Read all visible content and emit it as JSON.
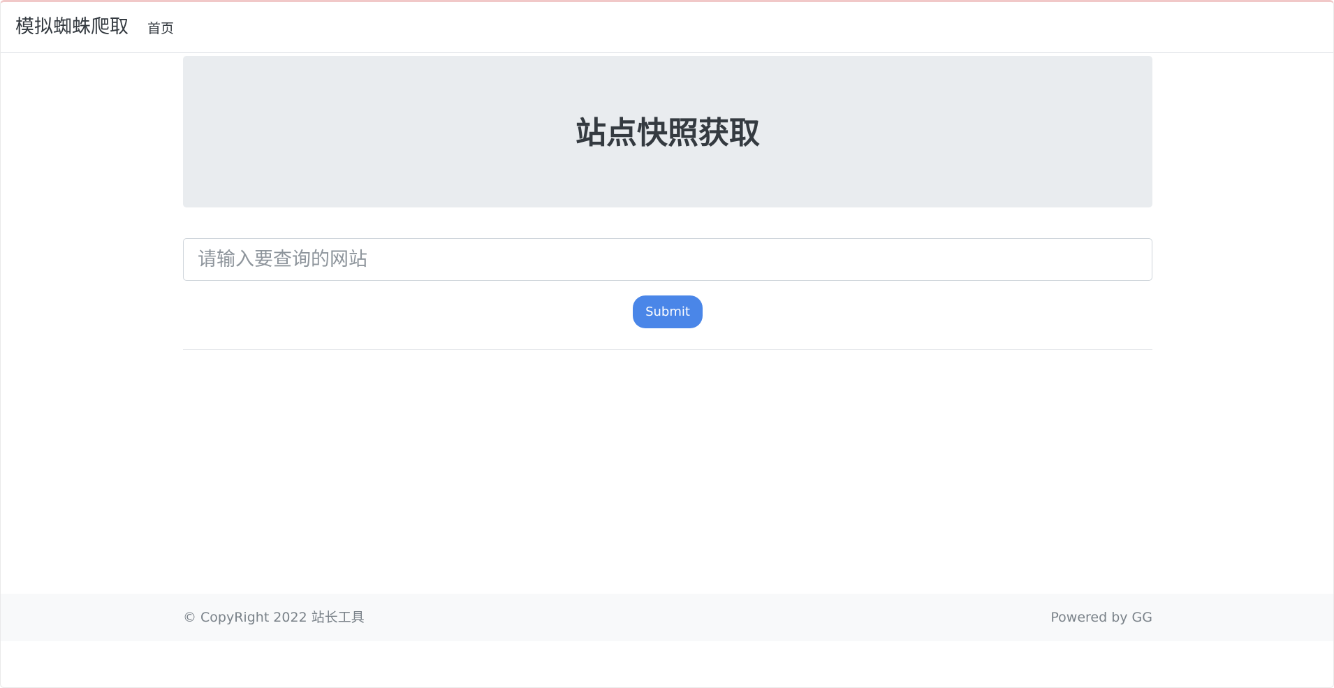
{
  "navbar": {
    "brand": "模拟蜘蛛爬取",
    "links": [
      {
        "label": "首页"
      }
    ]
  },
  "hero": {
    "title": "站点快照获取"
  },
  "form": {
    "site_placeholder": "请输入要查询的网站",
    "site_value": "",
    "submit_label": "Submit"
  },
  "footer": {
    "copyright": "© CopyRight 2022 站长工具",
    "powered_by": "Powered by GG"
  },
  "colors": {
    "primary_button": "#4a86e8",
    "jumbotron_bg": "#e9ecef",
    "footer_bg": "#f8f9fa",
    "text_dark": "#343a40",
    "text_muted": "#7a8289"
  }
}
